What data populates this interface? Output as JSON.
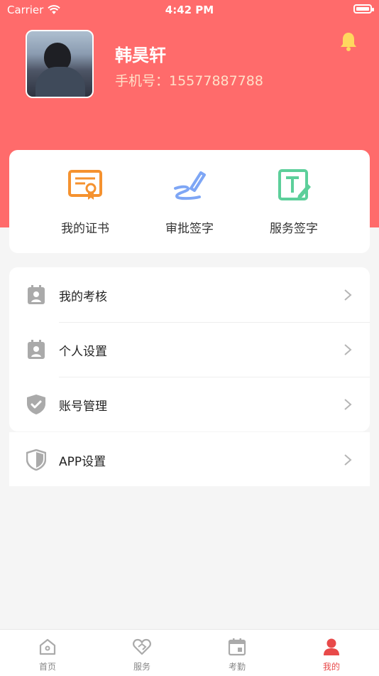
{
  "status_bar": {
    "carrier": "Carrier",
    "time": "4:42 PM"
  },
  "profile": {
    "name": "韩昊轩",
    "phone": "手机号：15577887788"
  },
  "quick_actions": [
    {
      "label": "我的证书",
      "icon": "certificate-icon",
      "color": "#f5922f"
    },
    {
      "label": "审批签字",
      "icon": "signature-pen-icon",
      "color": "#7ea6f5"
    },
    {
      "label": "服务签字",
      "icon": "text-edit-icon",
      "color": "#5ccf9a"
    }
  ],
  "menu": [
    {
      "label": "我的考核",
      "icon": "clipboard-person-icon"
    },
    {
      "label": "个人设置",
      "icon": "clipboard-person-icon"
    },
    {
      "label": "账号管理",
      "icon": "shield-check-icon"
    },
    {
      "label": "APP设置",
      "icon": "shield-icon"
    }
  ],
  "tabs": [
    {
      "label": "首页",
      "icon": "home-icon",
      "active": false
    },
    {
      "label": "服务",
      "icon": "heart-handshake-icon",
      "active": false
    },
    {
      "label": "考勤",
      "icon": "calendar-icon",
      "active": false
    },
    {
      "label": "我的",
      "icon": "user-icon",
      "active": true
    }
  ],
  "colors": {
    "header": "#ff6b6b",
    "accent": "#e84a4a",
    "bell": "#ffd75e",
    "menu_icon": "#aaaaaa"
  }
}
